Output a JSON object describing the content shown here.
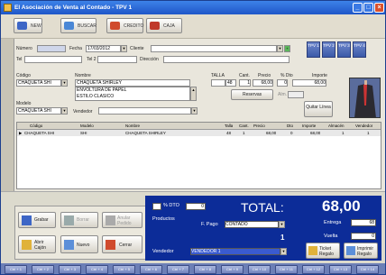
{
  "window": {
    "title": "El Asociación de Venta al Contado  -  TPV 1"
  },
  "toolbar": {
    "buttons": [
      {
        "label": "NEW",
        "icon": "new-doc-icon",
        "color": "#3d66c6"
      },
      {
        "label": "BUSCAR",
        "icon": "search-icon",
        "color": "#4a87d6"
      },
      {
        "label": "CREDITO",
        "icon": "credit-icon",
        "color": "#d04b2d"
      },
      {
        "label": "CAJA",
        "icon": "cash-icon",
        "color": "#c0392b"
      }
    ]
  },
  "header": {
    "numero_label": "Número",
    "numero_value": "",
    "fecha_label": "Fecha",
    "fecha_value": "17/03/2012",
    "cliente_label": "Cliente",
    "cliente_value": "",
    "tel_label": "Tel",
    "tel_value": "",
    "tel2_label": "Tel 2",
    "tel2_value": "",
    "direccion_label": "Dirección",
    "direccion_value": ""
  },
  "tpv": [
    "TPV 1",
    "TPV 2",
    "TPV 3",
    "TPV 4"
  ],
  "article": {
    "codigo_label": "Código",
    "codigo_value": "CHAQUETA SHI",
    "nombre_label": "Nombre",
    "nombre_value": "CHAQUETA SHIRLEY",
    "desc_lines": [
      "ENVOLTURA DE PAPEL",
      "ESTILO CLASICO"
    ],
    "modelo_label": "Modelo",
    "modelo_value": "CHAQUETA SHI",
    "vendedor_label": "Vendedor",
    "vendedor_value": "",
    "talla_label": "TALLA",
    "talla_value": "48",
    "qty_label": "Cant.",
    "qty_value": "1",
    "precio_label": "Precio",
    "precio_value": "68,00",
    "dto_label": "% Dto",
    "dto_value": "0",
    "importe_label": "Importe",
    "importe_value": "68,00",
    "reservas_label": "Reservas",
    "quitar_label": "Quitar Línea"
  },
  "grid": {
    "columns": [
      "Código",
      "Modelo",
      "Nombre",
      "Talla",
      "Cant.",
      "Precio",
      "Dto",
      "Importe",
      "Almacén",
      "Vendedor"
    ],
    "rows": [
      [
        "CHAQUETA SHI",
        "SHI",
        "CHAQUETA SHIRLEY",
        "48",
        "1",
        "68,00",
        "0",
        "68,00",
        "1",
        "1"
      ]
    ]
  },
  "totals": {
    "dto_label": "% DTO",
    "dto_value": "0",
    "productos_label": "Productos",
    "productos_value": "1",
    "fpago_label": "F. Pago",
    "fpago_value": "CONTADO",
    "total_label": "TOTAL:",
    "total_value": "68,00",
    "entrega_label": "Entrega",
    "entrega_value": "68",
    "vuelta_label": "Vuelta",
    "vuelta_value": "0",
    "vendedor_label": "Vendedor",
    "vendedor_value": "VENDEDOR 1",
    "ticket_regalo_label": "Ticket Regalo",
    "ticket_label": "Ticket",
    "grabar_label": "Grabar",
    "borrar_label": "Borrar",
    "anular_label": "Anular Pedido",
    "abrir_caja_label": "Abrir Cajón",
    "nuevo_label": "Nuevo",
    "cerrar_label": "Cerrar",
    "imprimir_label": "Imprimir Regalo"
  },
  "fkeys": [
    "Ctrl + 1",
    "Ctrl + 2",
    "Ctrl + 3",
    "Ctrl + 4",
    "Ctrl + 5",
    "Ctrl + 6",
    "Ctrl + 7",
    "Ctrl + 8",
    "Ctrl + 9",
    "Ctrl + 10",
    "Ctrl + 11",
    "Ctrl + 12",
    "Ctrl + 13",
    "Ctrl + 14"
  ],
  "colors": {
    "title": "#1f56c8",
    "total_panel": "#0c2c98",
    "accent": "#3a5bd0"
  }
}
